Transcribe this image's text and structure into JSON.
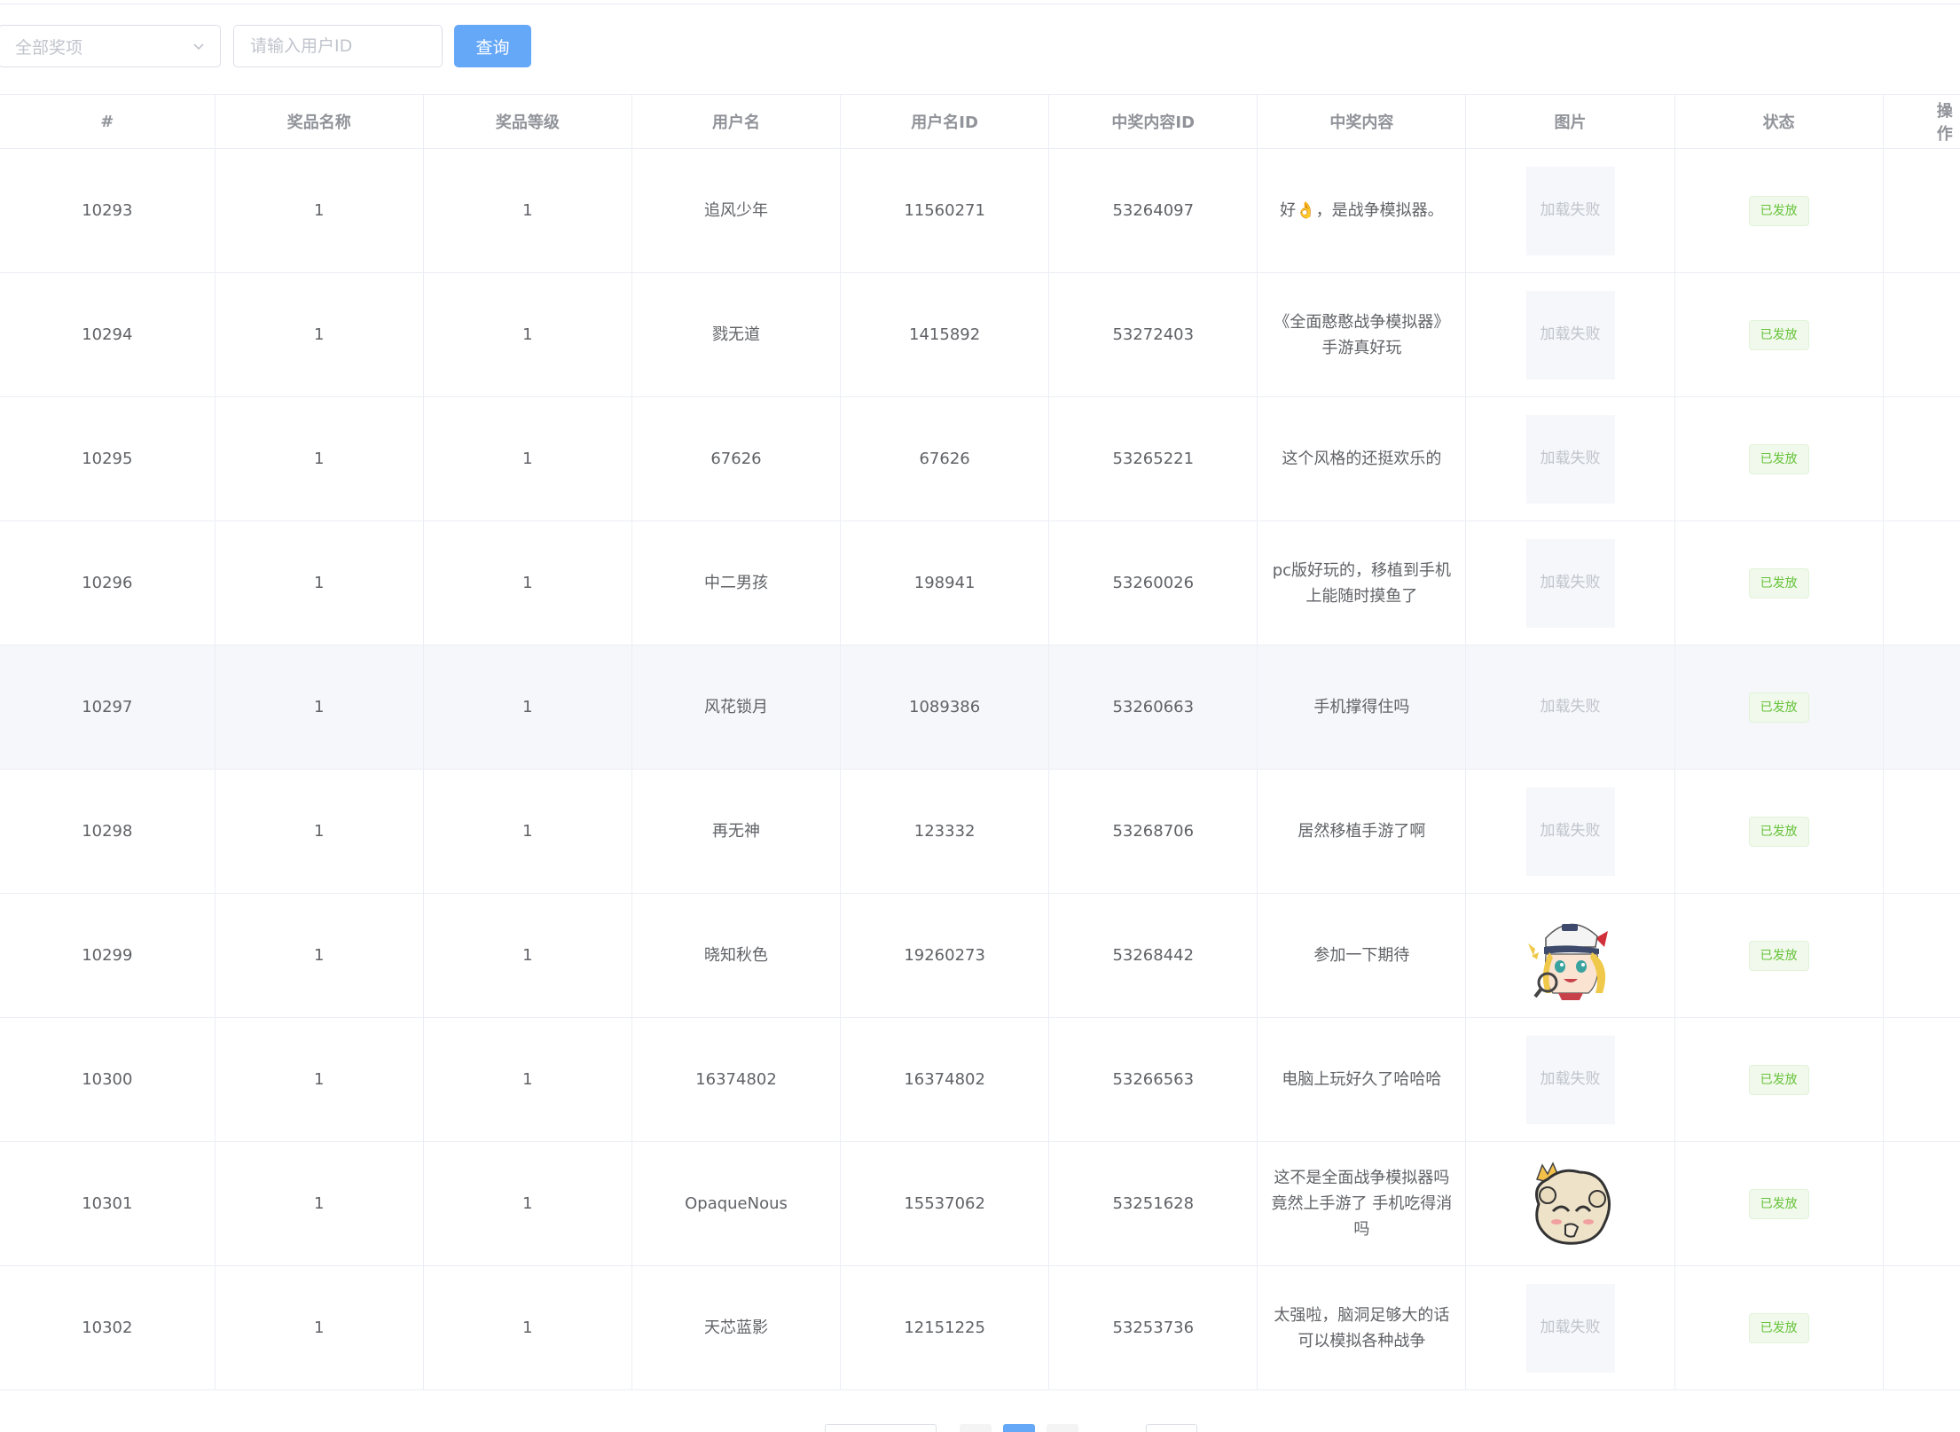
{
  "filters": {
    "prize_select_value": "全部奖项",
    "user_id_placeholder": "请输入用户ID",
    "query_label": "查询"
  },
  "table": {
    "headers": [
      "#",
      "奖品名称",
      "奖品等级",
      "用户名",
      "用户名ID",
      "中奖内容ID",
      "中奖内容",
      "图片",
      "状态",
      "操作"
    ],
    "rows": [
      {
        "id": "10293",
        "prize_name": "1",
        "prize_level": "1",
        "username": "追风少年",
        "user_id": "11560271",
        "content_id": "53264097",
        "content": "好👌，是战争模拟器。",
        "image": "加载失败",
        "image_type": "fail",
        "status": "已发放"
      },
      {
        "id": "10294",
        "prize_name": "1",
        "prize_level": "1",
        "username": "戮无道",
        "user_id": "1415892",
        "content_id": "53272403",
        "content": "《全面憨憨战争模拟器》手游真好玩",
        "image": "加载失败",
        "image_type": "fail",
        "status": "已发放"
      },
      {
        "id": "10295",
        "prize_name": "1",
        "prize_level": "1",
        "username": "67626",
        "user_id": "67626",
        "content_id": "53265221",
        "content": "这个风格的还挺欢乐的",
        "image": "加载失败",
        "image_type": "fail",
        "status": "已发放"
      },
      {
        "id": "10296",
        "prize_name": "1",
        "prize_level": "1",
        "username": "中二男孩",
        "user_id": "198941",
        "content_id": "53260026",
        "content": "pc版好玩的，移植到手机上能随时摸鱼了",
        "image": "加载失败",
        "image_type": "fail",
        "status": "已发放"
      },
      {
        "id": "10297",
        "prize_name": "1",
        "prize_level": "1",
        "username": "风花锁月",
        "user_id": "1089386",
        "content_id": "53260663",
        "content": "手机撑得住吗",
        "image": "加载失败",
        "image_type": "fail",
        "status": "已发放"
      },
      {
        "id": "10298",
        "prize_name": "1",
        "prize_level": "1",
        "username": "再无神",
        "user_id": "123332",
        "content_id": "53268706",
        "content": "居然移植手游了啊",
        "image": "加载失败",
        "image_type": "fail",
        "status": "已发放"
      },
      {
        "id": "10299",
        "prize_name": "1",
        "prize_level": "1",
        "username": "晓知秋色",
        "user_id": "19260273",
        "content_id": "53268442",
        "content": "参加一下期待",
        "image": "",
        "image_type": "avatar-girl",
        "status": "已发放"
      },
      {
        "id": "10300",
        "prize_name": "1",
        "prize_level": "1",
        "username": "16374802",
        "user_id": "16374802",
        "content_id": "53266563",
        "content": "电脑上玩好久了哈哈哈",
        "image": "加载失败",
        "image_type": "fail",
        "status": "已发放"
      },
      {
        "id": "10301",
        "prize_name": "1",
        "prize_level": "1",
        "username": "OpaqueNous",
        "user_id": "15537062",
        "content_id": "53251628",
        "content": "这不是全面战争模拟器吗竟然上手游了 手机吃得消吗",
        "image": "",
        "image_type": "avatar-king",
        "status": "已发放"
      },
      {
        "id": "10302",
        "prize_name": "1",
        "prize_level": "1",
        "username": "天芯蓝影",
        "user_id": "12151225",
        "content_id": "53253736",
        "content": "太强啦，脑洞足够大的话可以模拟各种战争",
        "image": "加载失败",
        "image_type": "fail",
        "status": "已发放"
      }
    ]
  },
  "colors": {
    "primary": "#66a8f8",
    "success_text": "#67c23a",
    "success_bg": "#f0f9eb",
    "border": "#ebeef5"
  }
}
